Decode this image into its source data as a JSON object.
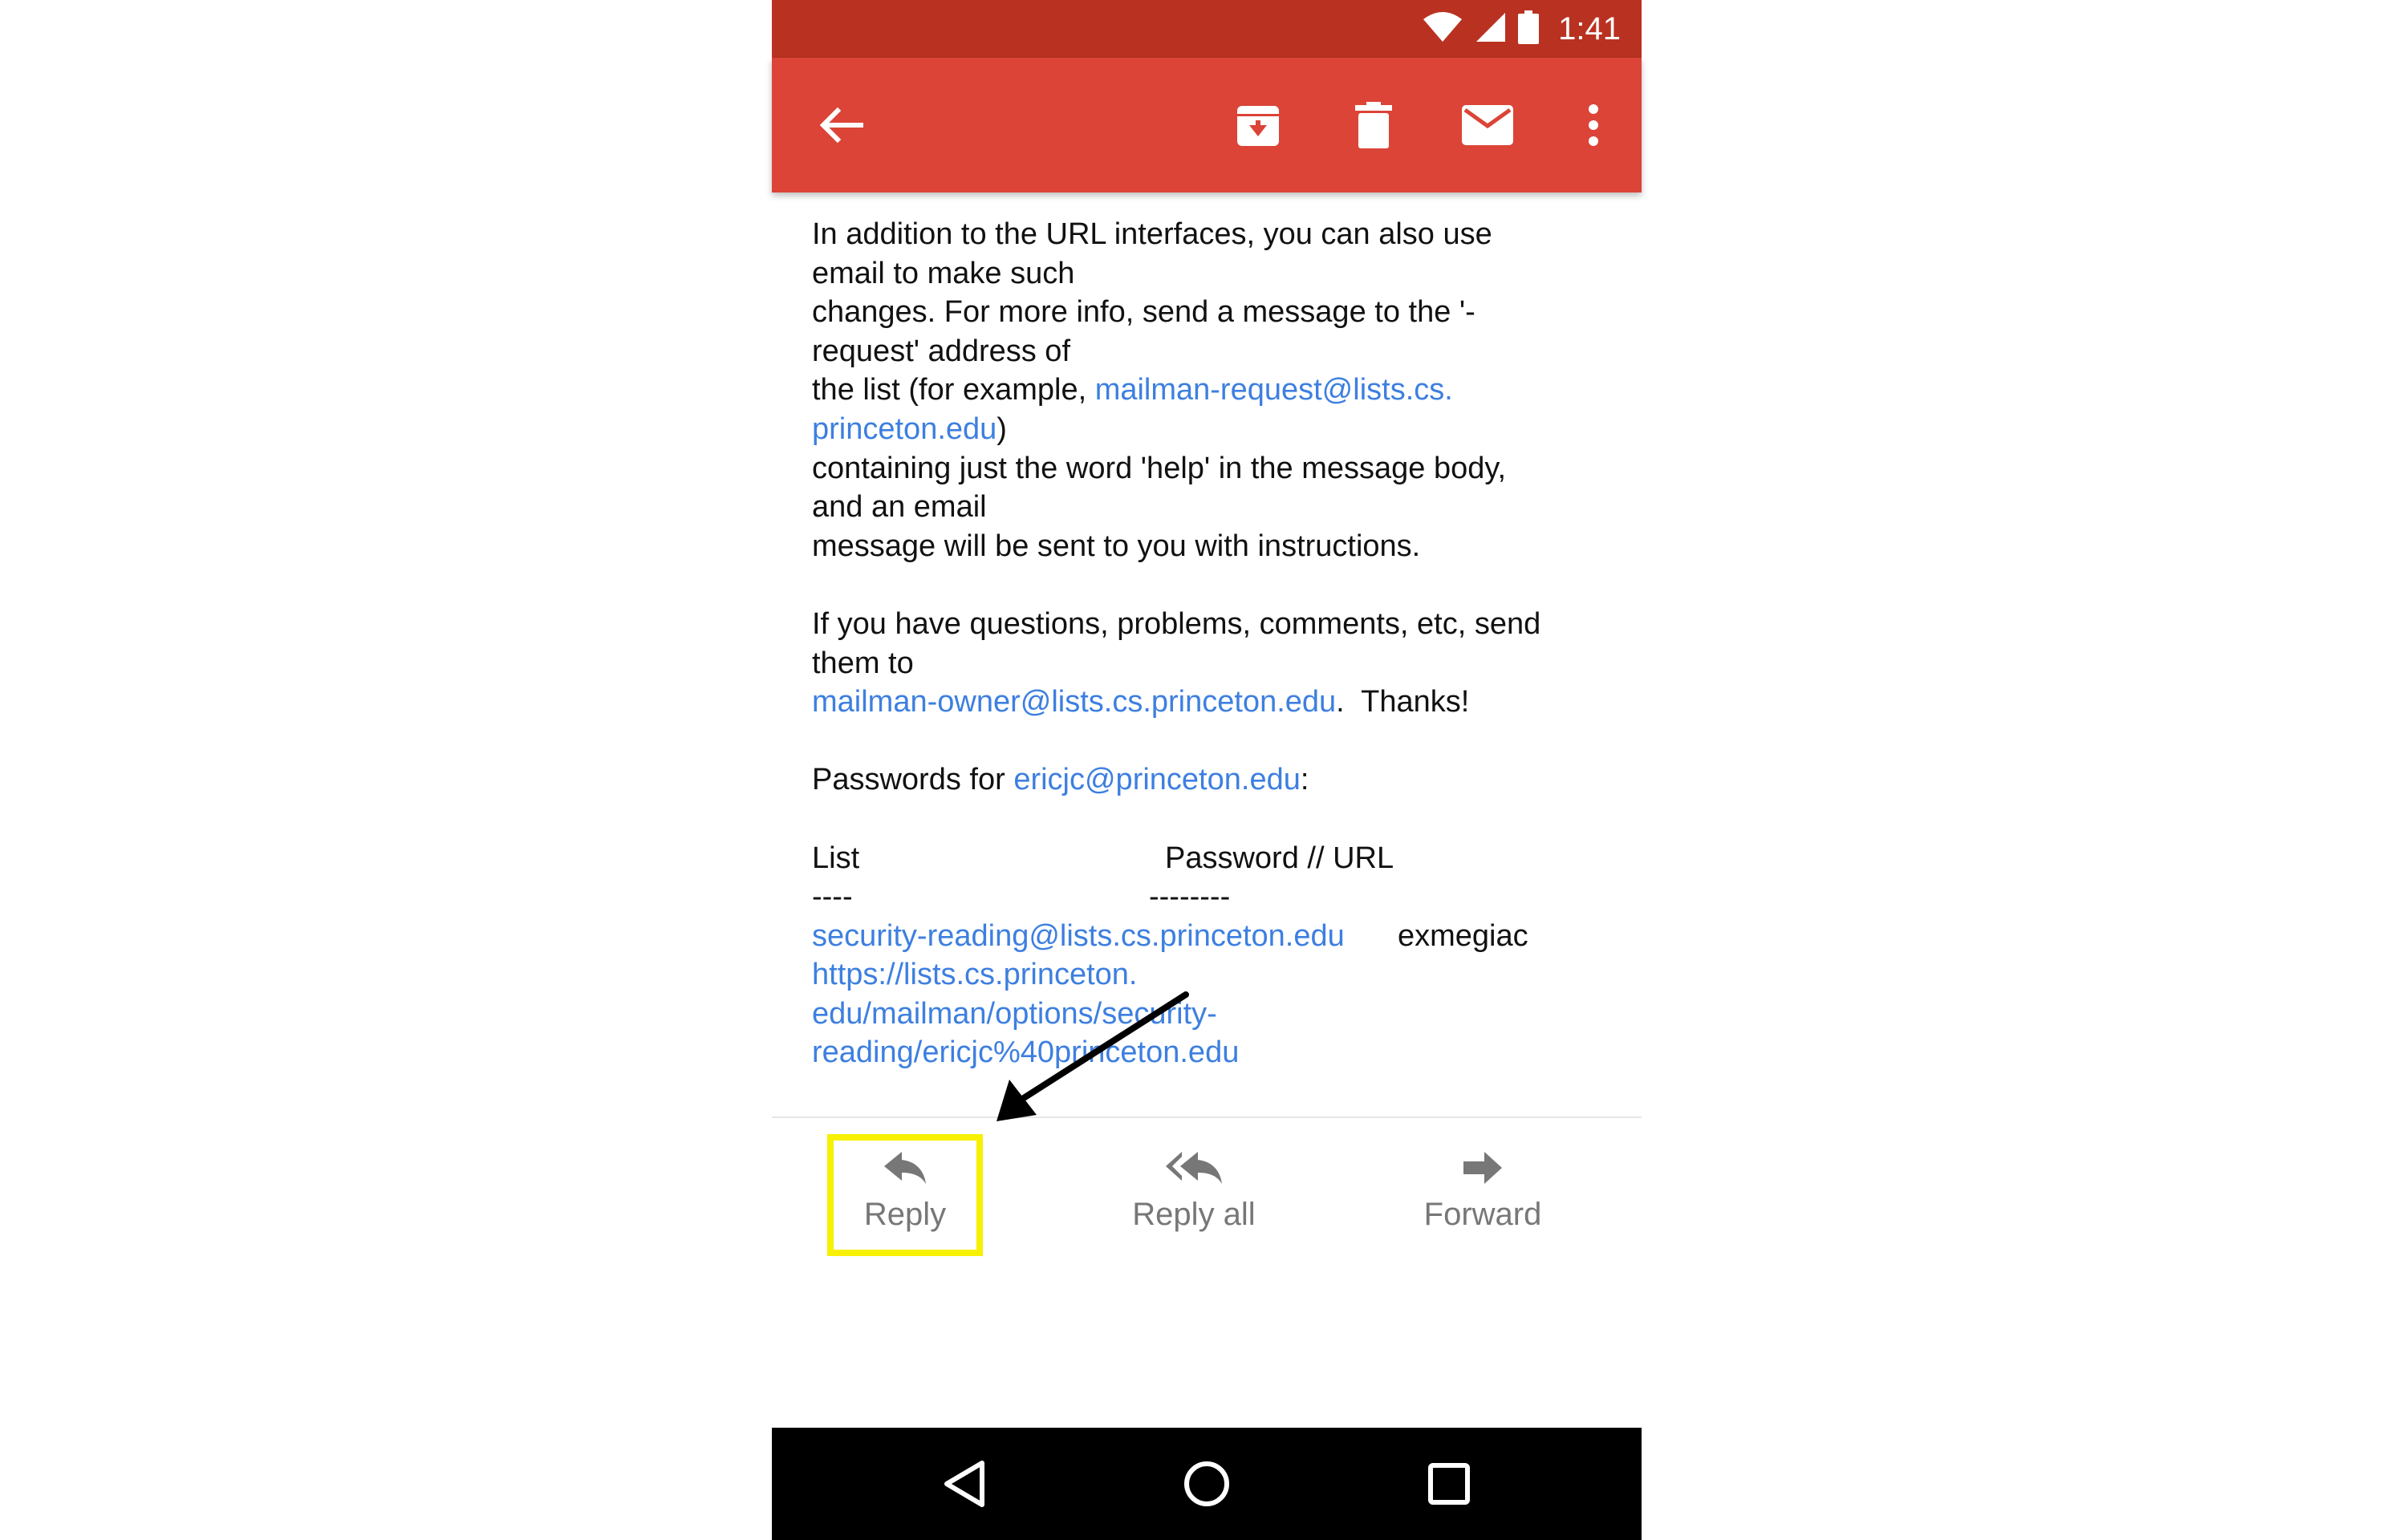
{
  "status_bar": {
    "time": "1:41",
    "icons": [
      "wifi-icon",
      "signal-icon",
      "battery-icon"
    ]
  },
  "app_bar": {
    "actions": [
      "back-arrow-icon",
      "archive-icon",
      "delete-icon",
      "mark-unread-icon",
      "more-vert-icon"
    ]
  },
  "body": {
    "p1": {
      "line1": "In addition to the URL interfaces, you can also use",
      "line2": "email to make such",
      "line3": "changes.  For more info, send a message to the '-",
      "line4": "request' address of",
      "line5_prefix": "the list (for example, ",
      "line5_link": "mailman-request@lists.cs.",
      "line6_link": "princeton.edu",
      "line6_suffix": ")",
      "line7": "containing just the word 'help' in the message body,",
      "line8": "and an email",
      "line9": "message will be sent to you with instructions."
    },
    "p2": {
      "line1": "If you have questions, problems, comments, etc, send",
      "line2": "them to",
      "line3_link": "mailman-owner@lists.cs.princeton.edu",
      "line3_suffix": ".  Thanks!"
    },
    "p3": {
      "prefix": "Passwords for ",
      "link": "ericjc@princeton.edu",
      "suffix": ":"
    },
    "table": {
      "header_list": "List",
      "header_password": "Password // URL",
      "sep_list": "----",
      "sep_password": "--------",
      "row_list_link": "security-reading@lists.cs.princeton.edu",
      "row_password": "exmegiac",
      "url_line1": "https://lists.cs.princeton.",
      "url_line2": "edu/mailman/options/security-",
      "url_line3": "reading/ericjc%40princeton.edu"
    }
  },
  "actions": {
    "reply": "Reply",
    "reply_all": "Reply all",
    "forward": "Forward"
  },
  "annotation": {
    "highlight_color": "#f7f000",
    "arrow_color": "#000000"
  },
  "colors": {
    "status_bar": "#b93221",
    "app_bar": "#db4437",
    "link": "#3d7fe0"
  }
}
